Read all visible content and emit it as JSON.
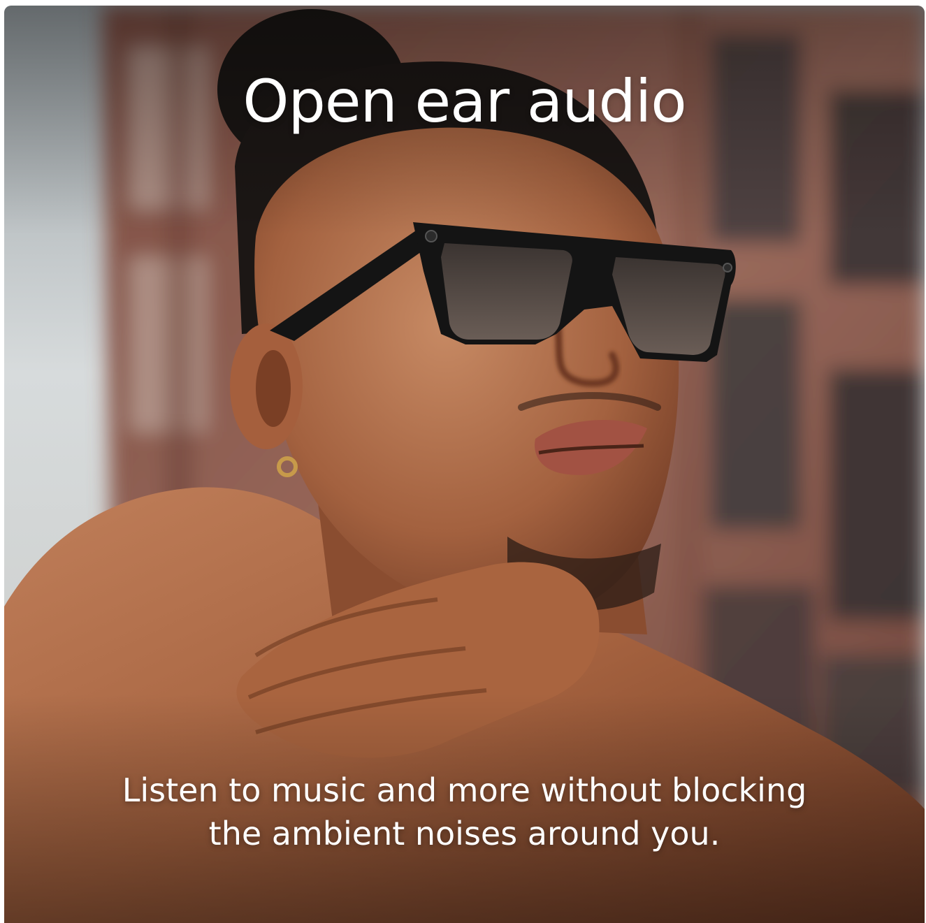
{
  "headline": "Open ear audio",
  "caption": {
    "line1": "Listen to music and more without blocking",
    "line2": "the ambient noises around you."
  },
  "colors": {
    "sky": "#c9ced1",
    "brick": "#8a5a4c",
    "skin": "#a9694a",
    "hair": "#1a1614",
    "frames": "#141414",
    "text": "#ffffff"
  }
}
